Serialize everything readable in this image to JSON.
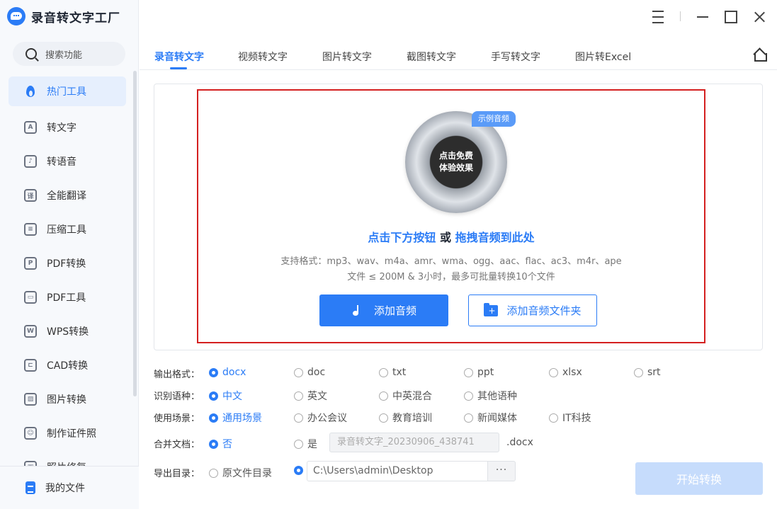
{
  "app": {
    "name": "录音转文字工厂"
  },
  "sidebar": {
    "search_label": "搜索功能",
    "items": [
      {
        "label": "热门工具",
        "icon": "flame-icon",
        "glyph": ""
      },
      {
        "label": "转文字",
        "icon": "text-convert-icon",
        "glyph": "A"
      },
      {
        "label": "转语音",
        "icon": "voice-icon",
        "glyph": "♪"
      },
      {
        "label": "全能翻译",
        "icon": "translate-icon",
        "glyph": "译"
      },
      {
        "label": "压缩工具",
        "icon": "compress-icon",
        "glyph": "≡"
      },
      {
        "label": "PDF转换",
        "icon": "pdf-convert-icon",
        "glyph": "P"
      },
      {
        "label": "PDF工具",
        "icon": "briefcase-icon",
        "glyph": "▭"
      },
      {
        "label": "WPS转换",
        "icon": "wps-icon",
        "glyph": "W"
      },
      {
        "label": "CAD转换",
        "icon": "cad-icon",
        "glyph": "⊏"
      },
      {
        "label": "图片转换",
        "icon": "image-icon",
        "glyph": "▨"
      },
      {
        "label": "制作证件照",
        "icon": "id-photo-icon",
        "glyph": "☺"
      },
      {
        "label": "照片修复",
        "icon": "photo-repair-icon",
        "glyph": "▣"
      }
    ],
    "footer_label": "我的文件"
  },
  "tabs": [
    {
      "label": "录音转文字",
      "active": true
    },
    {
      "label": "视频转文字",
      "active": false
    },
    {
      "label": "图片转文字",
      "active": false
    },
    {
      "label": "截图转文字",
      "active": false
    },
    {
      "label": "手写转文字",
      "active": false
    },
    {
      "label": "图片转Excel",
      "active": false
    }
  ],
  "dropzone": {
    "sample_badge": "示例音频",
    "disc_line1": "点击免费",
    "disc_line2": "体验效果",
    "title_part1": "点击下方按钮",
    "title_or": " 或 ",
    "title_part2": "拖拽音频到此处",
    "formats": "支持格式：mp3、wav、m4a、amr、wma、ogg、aac、flac、ac3、m4r、ape",
    "limits": "文件 ≤ 200M & 3小时，最多可批量转换10个文件",
    "add_audio": "添加音频",
    "add_folder": "添加音频文件夹"
  },
  "options": {
    "output_format": {
      "label": "输出格式：",
      "choices": [
        "docx",
        "doc",
        "txt",
        "ppt",
        "xlsx",
        "srt"
      ],
      "selected": "docx"
    },
    "language": {
      "label": "识别语种：",
      "choices": [
        "中文",
        "英文",
        "中英混合",
        "其他语种"
      ],
      "selected": "中文"
    },
    "scene": {
      "label": "使用场景：",
      "choices": [
        "通用场景",
        "办公会议",
        "教育培训",
        "新闻媒体",
        "IT科技"
      ],
      "selected": "通用场景"
    },
    "merge": {
      "label": "合并文档：",
      "choices": [
        "否",
        "是"
      ],
      "selected": "否",
      "filename": "录音转文字_20230906_438741",
      "suffix": ".docx"
    },
    "export": {
      "label": "导出目录：",
      "choices": [
        "原文件目录",
        ""
      ],
      "selected": "",
      "path": "C:\\Users\\admin\\Desktop",
      "browse": "···"
    }
  },
  "start_button": "开始转换",
  "colors": {
    "accent": "#2b7cf6",
    "dropzone_border": "#d42020",
    "start_disabled": "#c6dcfc"
  }
}
